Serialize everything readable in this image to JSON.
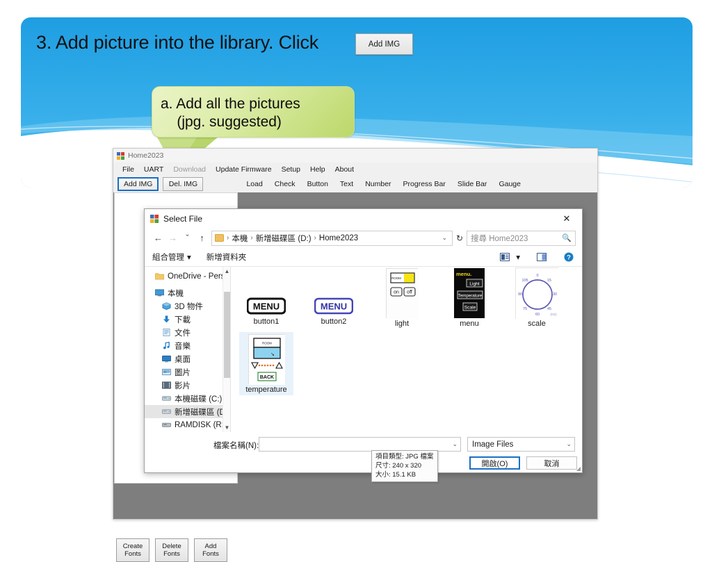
{
  "slide": {
    "title": "3. Add picture into the library. Click",
    "title_chip_label": "Add IMG",
    "callout_text": "a. Add all the pictures\n    (jpg. suggested)",
    "bg_color": "#30a7e8",
    "callout_color": "#c3dc77"
  },
  "app": {
    "title": "Home2023",
    "menu": [
      {
        "label": "File",
        "disabled": false
      },
      {
        "label": "UART",
        "disabled": false
      },
      {
        "label": "Download",
        "disabled": true
      },
      {
        "label": "Update Firmware",
        "disabled": false
      },
      {
        "label": "Setup",
        "disabled": false
      },
      {
        "label": "Help",
        "disabled": false
      },
      {
        "label": "About",
        "disabled": false
      }
    ],
    "toolbar_buttons": [
      {
        "label": "Add IMG",
        "focused": true
      },
      {
        "label": "Del. IMG",
        "focused": false
      }
    ],
    "toolbar_links": [
      "Load",
      "Check",
      "Button",
      "Text",
      "Number",
      "Progress Bar",
      "Slide Bar",
      "Gauge"
    ],
    "font_buttons": [
      {
        "line1": "Create",
        "line2": "Fonts"
      },
      {
        "line1": "Delete",
        "line2": "Fonts"
      },
      {
        "line1": "Add",
        "line2": "Fonts"
      }
    ]
  },
  "dialog": {
    "title": "Select File",
    "close_label": "✕",
    "nav": {
      "back": "←",
      "forward": "→",
      "recent": "ˇ",
      "up": "↑"
    },
    "breadcrumb": [
      "本機",
      "新增磁碟區 (D:)",
      "Home2023"
    ],
    "breadcrumb_separator": "›",
    "refresh_label": "↻",
    "search_placeholder": "搜尋 Home2023",
    "toolbar": {
      "organize": "組合管理",
      "organize_caret": "▾",
      "new_folder": "新增資料夾",
      "view_caret": "▾"
    },
    "nav_tree": [
      {
        "label": "OneDrive - Perso",
        "icon": "folder-icon",
        "indent": false,
        "selected": false
      },
      {
        "label": "本機",
        "icon": "pc-icon",
        "indent": false,
        "selected": false
      },
      {
        "label": "3D 物件",
        "icon": "3d-icon",
        "indent": true,
        "selected": false
      },
      {
        "label": "下載",
        "icon": "download-icon",
        "indent": true,
        "selected": false
      },
      {
        "label": "文件",
        "icon": "documents-icon",
        "indent": true,
        "selected": false
      },
      {
        "label": "音樂",
        "icon": "music-icon",
        "indent": true,
        "selected": false
      },
      {
        "label": "桌面",
        "icon": "desktop-icon",
        "indent": true,
        "selected": false
      },
      {
        "label": "圖片",
        "icon": "pictures-icon",
        "indent": true,
        "selected": false
      },
      {
        "label": "影片",
        "icon": "videos-icon",
        "indent": true,
        "selected": false
      },
      {
        "label": "本機磁碟 (C:)",
        "icon": "drive-icon",
        "indent": true,
        "selected": false
      },
      {
        "label": "新增磁碟區 (D:)",
        "icon": "drive-icon",
        "indent": true,
        "selected": true
      },
      {
        "label": "RAMDISK (R:)",
        "icon": "drive-icon",
        "indent": true,
        "selected": false
      }
    ],
    "files": [
      {
        "name": "button1",
        "kind": "menu-black",
        "selected": false
      },
      {
        "name": "button2",
        "kind": "menu-blue",
        "selected": false
      },
      {
        "name": "light",
        "kind": "light",
        "selected": false
      },
      {
        "name": "menu",
        "kind": "menu-dark",
        "selected": false
      },
      {
        "name": "scale",
        "kind": "scale",
        "selected": false
      },
      {
        "name": "temperature",
        "kind": "temperature",
        "selected": true
      }
    ],
    "thumb_art": {
      "menu_label": "MENU",
      "light_room_label": "ROOM",
      "light_on": "on",
      "light_off": "off",
      "menu_title": "menu.",
      "menu_items": [
        "Light",
        "Temperature",
        "Scale"
      ],
      "scale_ticks": [
        "0",
        "15",
        "30",
        "45",
        "60",
        "75",
        "90",
        "105"
      ],
      "scale_unit": "(KG)",
      "temp_room_label": "ROOM",
      "temp_back": "BACK"
    },
    "tooltip": {
      "line1": "項目類型: JPG 檔案",
      "line2": "尺寸: 240 x 320",
      "line3": "大小: 15.1 KB"
    },
    "footer": {
      "filename_label": "檔案名稱(N):",
      "filename_value": "",
      "filter_value": "Image Files",
      "open_label": "開啟(O)",
      "cancel_label": "取消",
      "caret": "⌄"
    }
  }
}
